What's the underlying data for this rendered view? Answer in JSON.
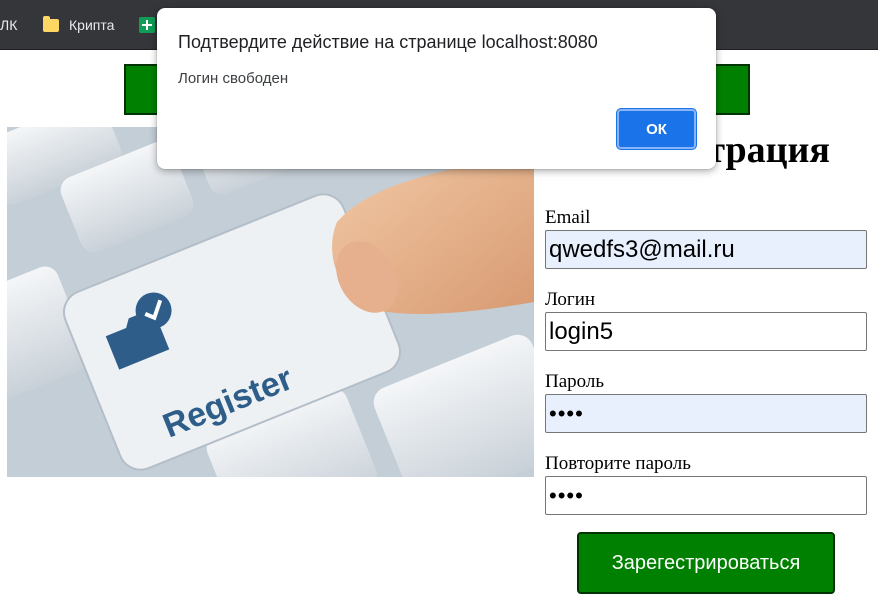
{
  "bookmarks": {
    "items": [
      {
        "label": "ЛК"
      },
      {
        "label": "Крипта",
        "icon": "folder-icon"
      }
    ],
    "extra_icon": "spreadsheet-icon"
  },
  "hero": {
    "key_label": "Register",
    "icon": "folder-check-icon"
  },
  "form": {
    "title": "Регистрация",
    "email_label": "Email",
    "email_value": "qwedfs3@mail.ru",
    "login_label": "Логин",
    "login_value": "login5",
    "password_label": "Пароль",
    "password_value": "••••",
    "repeat_label": "Повторите пароль",
    "repeat_value": "••••",
    "submit_label": "Зарегестрироваться"
  },
  "dialog": {
    "title": "Подтвердите действие на странице localhost:8080",
    "message": "Логин свободен",
    "ok_label": "ОК"
  },
  "colors": {
    "accent_green": "#008000",
    "dialog_button": "#1a73e8",
    "autofill_bg": "#e8f0fe"
  }
}
